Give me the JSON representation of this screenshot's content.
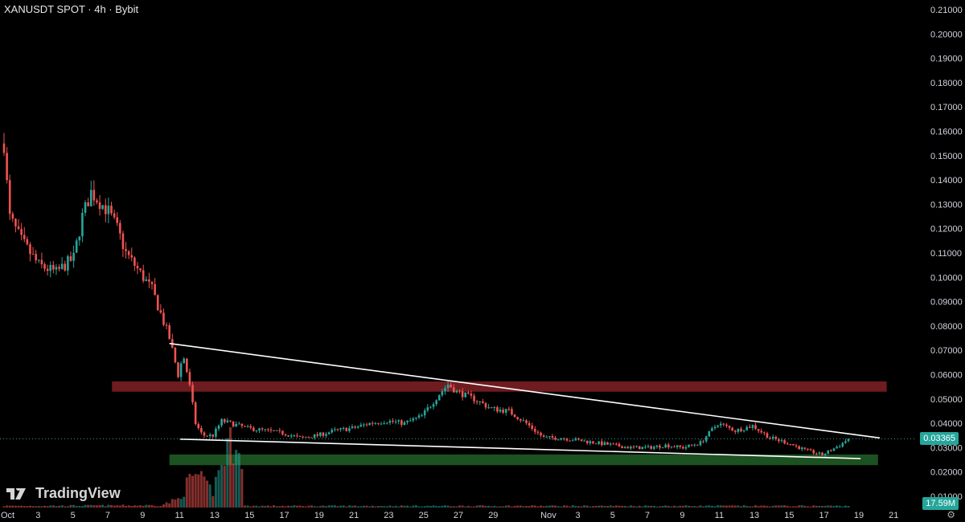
{
  "header": {
    "title": "XANUSDT SPOT · 4h · Bybit"
  },
  "branding": {
    "logo_text": "TradingView"
  },
  "colors": {
    "up": "#26a69a",
    "down": "#ef5350",
    "resistance_zone": "#7a1f24",
    "support_zone": "#1f5a25",
    "trendline": "#ffffff"
  },
  "chart_data": {
    "type": "candlestick",
    "title": "XANUSDT SPOT · 4h · Bybit",
    "interval": "4h",
    "ylim": [
      0.01,
      0.21
    ],
    "y_ticks": [
      "0.21000",
      "0.20000",
      "0.19000",
      "0.18000",
      "0.17000",
      "0.16000",
      "0.15000",
      "0.14000",
      "0.13000",
      "0.12000",
      "0.11000",
      "0.10000",
      "0.09000",
      "0.08000",
      "0.07000",
      "0.06000",
      "0.05000",
      "0.04000",
      "0.03000",
      "0.02000",
      "0.01000"
    ],
    "x_ticks": [
      {
        "day": 0,
        "label": "Oct"
      },
      {
        "day": 2,
        "label": "3"
      },
      {
        "day": 4,
        "label": "5"
      },
      {
        "day": 6,
        "label": "7"
      },
      {
        "day": 8,
        "label": "9"
      },
      {
        "day": 10,
        "label": "11"
      },
      {
        "day": 12,
        "label": "13"
      },
      {
        "day": 14,
        "label": "15"
      },
      {
        "day": 16,
        "label": "17"
      },
      {
        "day": 18,
        "label": "19"
      },
      {
        "day": 20,
        "label": "21"
      },
      {
        "day": 22,
        "label": "23"
      },
      {
        "day": 24,
        "label": "25"
      },
      {
        "day": 26,
        "label": "27"
      },
      {
        "day": 28,
        "label": "29"
      },
      {
        "day": 31,
        "label": "Nov"
      },
      {
        "day": 33,
        "label": "3"
      },
      {
        "day": 35,
        "label": "5"
      },
      {
        "day": 37,
        "label": "7"
      },
      {
        "day": 39,
        "label": "9"
      },
      {
        "day": 41,
        "label": "11"
      },
      {
        "day": 43,
        "label": "13"
      },
      {
        "day": 45,
        "label": "15"
      },
      {
        "day": 47,
        "label": "17"
      },
      {
        "day": 49,
        "label": "19"
      },
      {
        "day": 51,
        "label": "21"
      }
    ],
    "price_path": [
      [
        0,
        0.155
      ],
      [
        0.3,
        0.125
      ],
      [
        1,
        0.115
      ],
      [
        2,
        0.105
      ],
      [
        3,
        0.102
      ],
      [
        4,
        0.108
      ],
      [
        4.5,
        0.125
      ],
      [
        5,
        0.135
      ],
      [
        6,
        0.127
      ],
      [
        6.5,
        0.12
      ],
      [
        7,
        0.11
      ],
      [
        8,
        0.1
      ],
      [
        8.5,
        0.095
      ],
      [
        9,
        0.085
      ],
      [
        9.5,
        0.075
      ],
      [
        10,
        0.06
      ],
      [
        10.3,
        0.068
      ],
      [
        10.6,
        0.058
      ],
      [
        11,
        0.04
      ],
      [
        11.4,
        0.035
      ],
      [
        12,
        0.035
      ],
      [
        12.5,
        0.041
      ],
      [
        13,
        0.04
      ],
      [
        14,
        0.038
      ],
      [
        15,
        0.037
      ],
      [
        16,
        0.036
      ],
      [
        17,
        0.034
      ],
      [
        18,
        0.035
      ],
      [
        19,
        0.037
      ],
      [
        20,
        0.038
      ],
      [
        21,
        0.04
      ],
      [
        22,
        0.041
      ],
      [
        23,
        0.04
      ],
      [
        24,
        0.043
      ],
      [
        25,
        0.052
      ],
      [
        25.5,
        0.056
      ],
      [
        26,
        0.053
      ],
      [
        27,
        0.05
      ],
      [
        28,
        0.046
      ],
      [
        29,
        0.045
      ],
      [
        30,
        0.04
      ],
      [
        31,
        0.034
      ],
      [
        32,
        0.034
      ],
      [
        33,
        0.033
      ],
      [
        34,
        0.032
      ],
      [
        35,
        0.031
      ],
      [
        36,
        0.03
      ],
      [
        37,
        0.03
      ],
      [
        38,
        0.031
      ],
      [
        39,
        0.03
      ],
      [
        40,
        0.032
      ],
      [
        41,
        0.04
      ],
      [
        42,
        0.037
      ],
      [
        43,
        0.039
      ],
      [
        44,
        0.034
      ],
      [
        45,
        0.032
      ],
      [
        46,
        0.029
      ],
      [
        47,
        0.027
      ],
      [
        48,
        0.031
      ],
      [
        48.5,
        0.03365
      ]
    ],
    "volume_path": [
      [
        0,
        0.3
      ],
      [
        9,
        0.4
      ],
      [
        10,
        1.5
      ],
      [
        10.5,
        4
      ],
      [
        11,
        6
      ],
      [
        11.5,
        4
      ],
      [
        12,
        3
      ],
      [
        12.6,
        9
      ],
      [
        13,
        12
      ],
      [
        13.5,
        14
      ],
      [
        13.8,
        0.3
      ],
      [
        49,
        0.3
      ]
    ],
    "last_price": "0.03365",
    "last_volume": "17.59M",
    "zones": [
      {
        "name": "resistance",
        "from_day": 6.2,
        "to_day": 50.7,
        "low": 0.053,
        "high": 0.0572
      },
      {
        "name": "support",
        "from_day": 9.5,
        "to_day": 50.2,
        "low": 0.0228,
        "high": 0.0272
      }
    ],
    "trendlines": [
      {
        "name": "descending-resistance",
        "from": [
          9.5,
          0.0728
        ],
        "to": [
          50.3,
          0.034
        ]
      },
      {
        "name": "support-line",
        "from": [
          10.1,
          0.0335
        ],
        "to": [
          49.2,
          0.0255
        ]
      }
    ]
  }
}
